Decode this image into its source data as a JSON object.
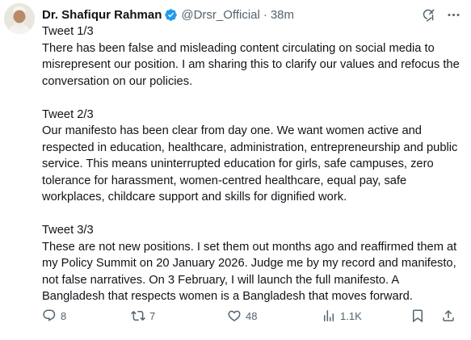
{
  "author": {
    "display_name": "Dr. Shafiqur Rahman",
    "handle": "@Drsr_Official",
    "separator": "·",
    "time": "38m",
    "verified_color": "#1d9bf0"
  },
  "tweet": {
    "blocks": [
      {
        "heading": "Tweet 1/3",
        "text": "There has been false and misleading content circulating on social media to misrepresent our position. I am sharing this to clarify our values and refocus the conversation on our policies."
      },
      {
        "heading": "Tweet 2/3",
        "text": "Our manifesto has been clear from day one. We want women active and respected in education, healthcare, administration, entrepreneurship and public service. This means uninterrupted education for girls, safe campuses, zero tolerance for harassment, women-centred healthcare, equal pay, safe workplaces, childcare support and skills for dignified work."
      },
      {
        "heading": "Tweet 3/3",
        "text": "These are not new positions. I set them out months ago and reaffirmed them at my Policy Summit on 20 January 2026. Judge me by my record and manifesto, not false narratives. On 3 February, I will launch the full manifesto. A Bangladesh that respects women is a Bangladesh that moves forward."
      }
    ]
  },
  "actions": {
    "replies": "8",
    "reposts": "7",
    "likes": "48",
    "views": "1.1K"
  },
  "icons": {
    "grok": "grok-icon",
    "more": "more-icon",
    "reply": "reply-icon",
    "repost": "repost-icon",
    "like": "heart-icon",
    "views": "views-icon",
    "bookmark": "bookmark-icon",
    "share": "share-icon"
  },
  "colors": {
    "text": "#0f1419",
    "secondary": "#536471",
    "verified": "#1d9bf0"
  }
}
